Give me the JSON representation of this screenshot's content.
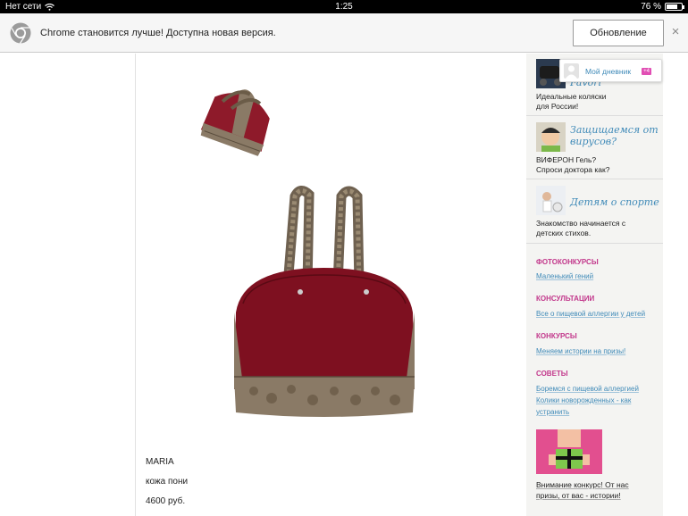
{
  "status_bar": {
    "carrier": "Нет сети",
    "time": "1:25",
    "battery": "76 %",
    "battery_level": 0.76
  },
  "infobar": {
    "message": "Chrome становится лучше! Доступна новая версия.",
    "update_label": "Обновление",
    "close_label": "×"
  },
  "product": {
    "name": "MARIA",
    "material": "кожа пони",
    "price": "4600 руб."
  },
  "sidebar": {
    "promos": [
      {
        "title": "Favori",
        "text_1": "Идеальные коляски",
        "text_2": "для России!"
      },
      {
        "title_1": "Защищаемся от",
        "title_2": "вирусов?",
        "text_1": "ВИФЕРОН Гель?",
        "text_2": "Спроси доктора как?"
      },
      {
        "title": "Детям о спорте",
        "text_1": "Знакомство начинается с",
        "text_2": "детских стихов."
      }
    ],
    "sections": [
      {
        "heading": "ФОТОКОНКУРСЫ",
        "links": [
          "Маленький гений"
        ]
      },
      {
        "heading": "КОНСУЛЬТАЦИИ",
        "links": [
          "Все о пищевой аллергии у детей"
        ]
      },
      {
        "heading": "КОНКУРСЫ",
        "links": [
          "Меняем истории на призы!"
        ]
      },
      {
        "heading": "СОВЕТЫ",
        "links": [
          "Боремся с пищевой аллергией",
          "Колики новорожденных - как",
          "устранить"
        ]
      }
    ],
    "contest_1": "Внимание конкурс! От нас",
    "contest_2": "призы, от вас - истории!"
  },
  "diary": {
    "label": "Мой дневник",
    "badge": "+4"
  },
  "colors": {
    "accent_link": "#3f8ab8",
    "section_heading": "#c2378b",
    "bag_red": "#7e1020",
    "snake_trim": "#8a7a66"
  }
}
